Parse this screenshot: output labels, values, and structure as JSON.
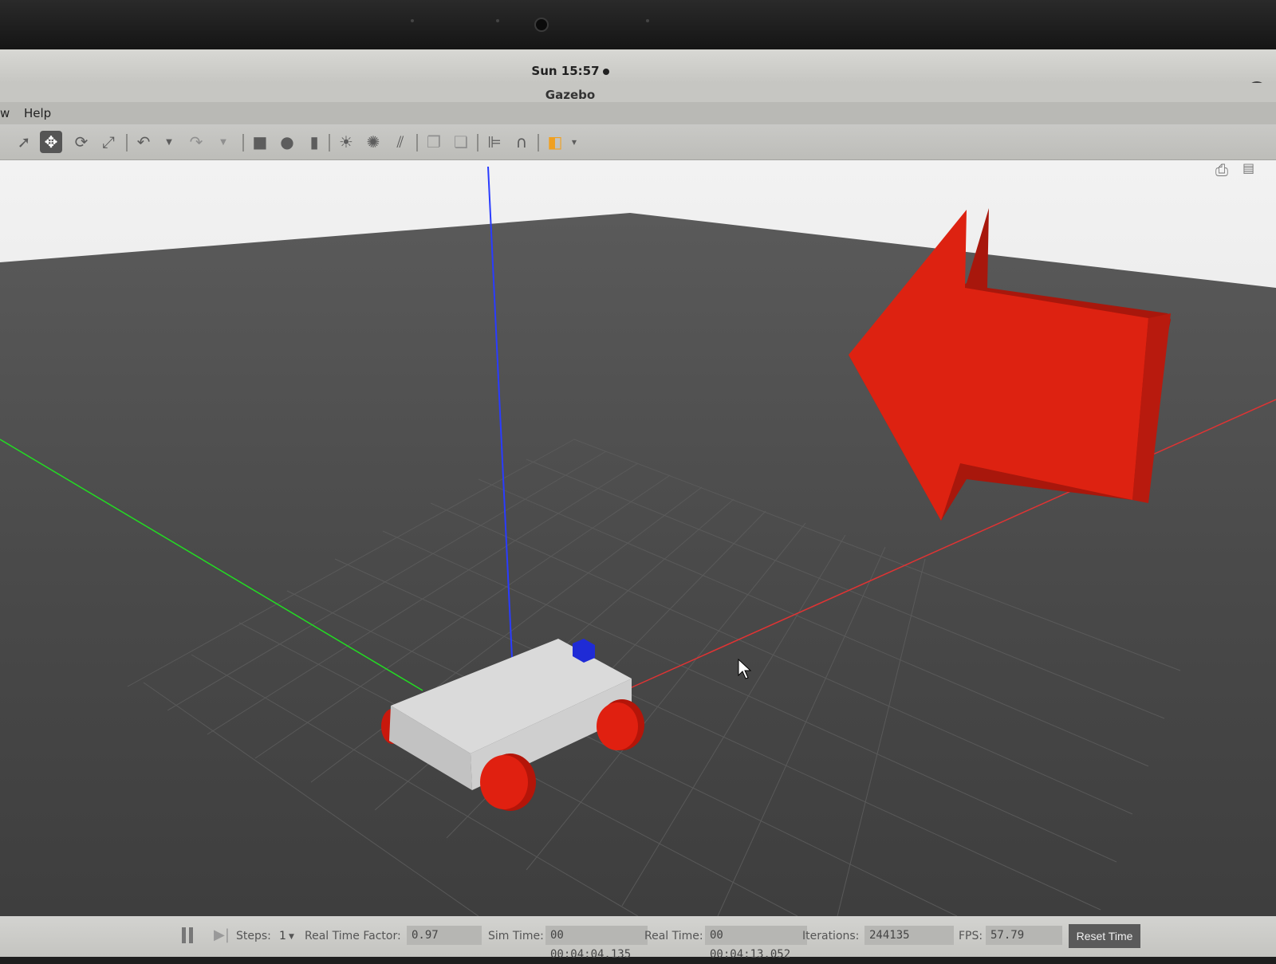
{
  "system": {
    "clock": "Sun 15:57",
    "language": "en"
  },
  "window": {
    "title": "Gazebo"
  },
  "menu": {
    "items": [
      "w",
      "Help"
    ]
  },
  "toolbar": {
    "tools": [
      {
        "name": "select-mode",
        "icon": "arrow-cursor-icon"
      },
      {
        "name": "translate-mode",
        "icon": "move-arrows-icon",
        "active": true
      },
      {
        "name": "rotate-mode",
        "icon": "rotate-icon"
      },
      {
        "name": "scale-mode",
        "icon": "scale-icon"
      },
      {
        "name": "undo",
        "icon": "undo-icon"
      },
      {
        "name": "redo",
        "icon": "redo-icon"
      },
      {
        "name": "box-shape",
        "icon": "box-icon"
      },
      {
        "name": "sphere-shape",
        "icon": "sphere-icon"
      },
      {
        "name": "cylinder-shape",
        "icon": "cylinder-icon"
      },
      {
        "name": "point-light",
        "icon": "sun-icon"
      },
      {
        "name": "spot-light",
        "icon": "spotlight-icon"
      },
      {
        "name": "directional-light",
        "icon": "directional-light-icon"
      },
      {
        "name": "copy",
        "icon": "copy-icon"
      },
      {
        "name": "paste",
        "icon": "paste-icon"
      },
      {
        "name": "align",
        "icon": "align-icon"
      },
      {
        "name": "snap",
        "icon": "magnet-icon"
      },
      {
        "name": "view-angle",
        "icon": "view-cube-icon"
      }
    ]
  },
  "viewport_actions": {
    "screenshot_icon": "camera-icon",
    "log_icon": "log-icon"
  },
  "status": {
    "steps_label": "Steps:",
    "steps_value": "1",
    "rtf_label": "Real Time Factor:",
    "rtf_value": "0.97",
    "sim_time_label": "Sim Time:",
    "sim_time_value": "00 00:04:04.135",
    "real_time_label": "Real Time:",
    "real_time_value": "00 00:04:13.052",
    "iterations_label": "Iterations:",
    "iterations_value": "244135",
    "fps_label": "FPS:",
    "fps_value": "57.79",
    "reset_label": "Reset Time"
  },
  "scene": {
    "objects": [
      "robot-car",
      "red-arrow-model",
      "blue-marker"
    ],
    "colors": {
      "ground": "#4a4a4a",
      "sky": "#e8e8e8",
      "robot_body": "#d9d9d9",
      "wheels": "#e02010",
      "arrow": "#dd2211",
      "marker": "#1f2bd6",
      "x_axis": "#e03030",
      "y_axis": "#20d020",
      "z_axis": "#2a3cff"
    }
  }
}
